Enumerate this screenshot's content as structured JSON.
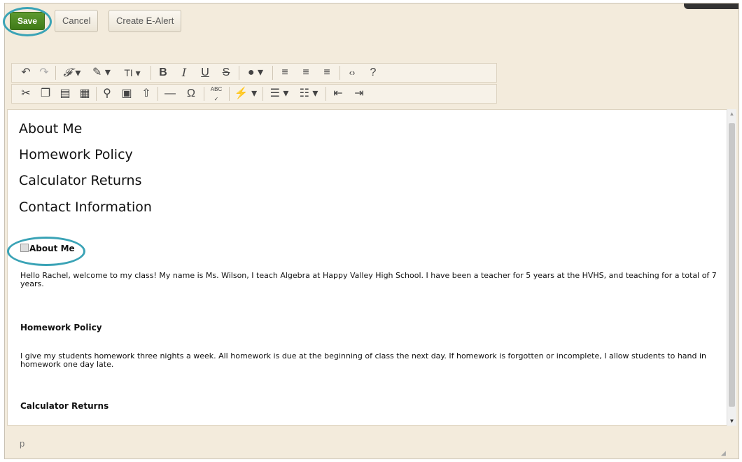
{
  "buttons": {
    "save": "Save",
    "cancel": "Cancel",
    "create_alert": "Create E-Alert"
  },
  "toolbar": {
    "row1": [
      "undo-icon",
      "redo-icon",
      "font-family-icon",
      "font-color-icon",
      "font-size-icon",
      "bold-icon",
      "italic-icon",
      "underline-icon",
      "strikethrough-icon",
      "background-color-icon",
      "align-left-icon",
      "align-center-icon",
      "align-right-icon",
      "code-view-icon",
      "help-icon"
    ],
    "row2": [
      "cut-icon",
      "copy-icon",
      "paste-icon",
      "paste-text-icon",
      "link-icon",
      "image-icon",
      "upload-icon",
      "horizontal-rule-icon",
      "special-char-icon",
      "spellcheck-icon",
      "quick-insert-icon",
      "bullet-list-icon",
      "numbered-list-icon",
      "outdent-icon",
      "indent-icon"
    ],
    "glyphs": {
      "bold": "B",
      "italic": "I",
      "underline": "U",
      "strike": "S",
      "font_size": "TI",
      "omega": "Ω",
      "spell": "ABC"
    }
  },
  "editor": {
    "links": [
      "About Me",
      "Homework Policy",
      "Calculator Returns",
      "Contact Information"
    ],
    "sections": [
      {
        "heading": "About Me",
        "text": "Hello Rachel, welcome to my class! My name is Ms. Wilson, I teach Algebra at Happy Valley High School. I have been a teacher for 5 years at the HVHS, and teaching for a total of 7 years."
      },
      {
        "heading": "Homework Policy",
        "text": "I give my students homework three nights a week. All homework is due at the beginning of class the next day. If homework is forgotten or incomplete, I allow students to hand in homework one day late."
      },
      {
        "heading": "Calculator Returns",
        "text": ""
      }
    ]
  },
  "status": {
    "path": "p"
  },
  "colors": {
    "save": "#4a8a20",
    "highlight_ring": "#3aa3b6",
    "chrome": "#f3ebdc"
  }
}
